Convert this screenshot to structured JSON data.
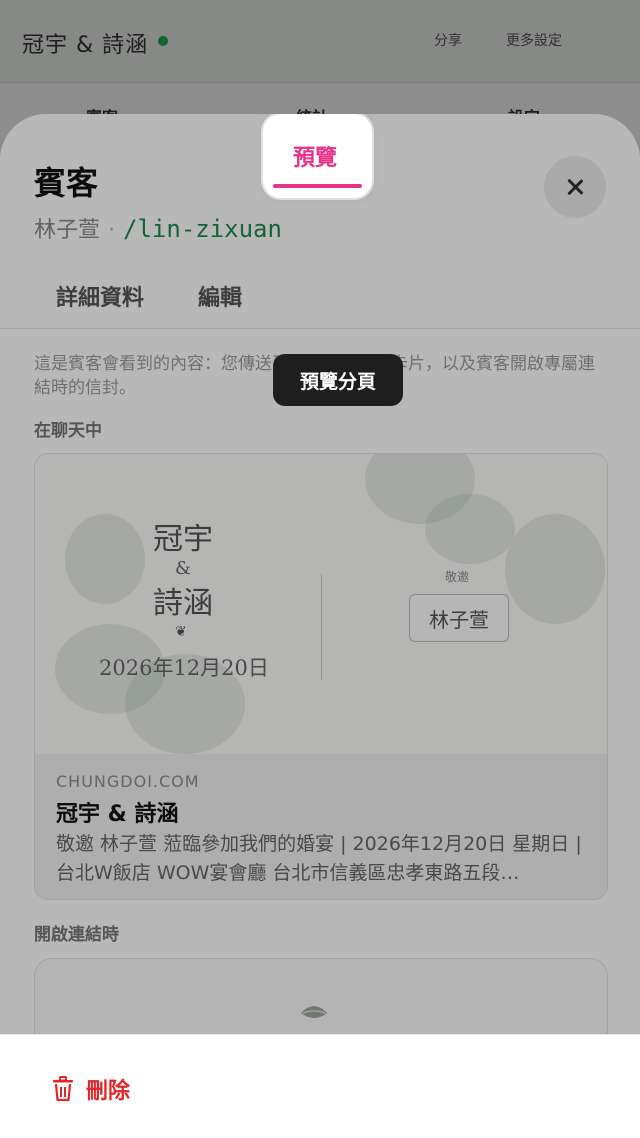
{
  "background": {
    "title": "冠宇 & 詩涵",
    "btn1": "分享",
    "btn2": "更多設定",
    "tabs": [
      "賓客",
      "統計",
      "設定"
    ]
  },
  "sheet": {
    "title": "賓客",
    "guest_name": "林子萱",
    "separator": "·",
    "slug": "/lin-zixuan",
    "tabs": {
      "details": "詳細資料",
      "edit": "編輯",
      "preview": "預覽"
    },
    "tooltip": "預覽分頁",
    "description": "這是賓客會看到的內容：您傳送到聊天中的連結卡片，以及賓客開啟專屬連結時的信封。",
    "in_chat_label": "在聊天中",
    "on_open_label": "開啟連結時",
    "card": {
      "couple_name_1": "冠宇",
      "ampersand": "&",
      "couple_name_2": "詩涵",
      "ornament": "❦",
      "date": "2026年12月20日",
      "invite_label": "敬邀",
      "guest": "林子萱",
      "domain": "CHUNGDOI.COM",
      "title": "冠宇 & 詩涵",
      "desc": "敬邀 林子萱 蒞臨參加我們的婚宴 | 2026年12月20日 星期日 | 台北W飯店 WOW宴會廳 台北市信義區忠孝東路五段…"
    },
    "footer": {
      "delete_label": "刪除"
    }
  },
  "colors": {
    "accent": "#e8338a",
    "slug": "#1a8c52",
    "danger": "#e0282a"
  },
  "icons": {
    "close": "close-icon",
    "delete": "trash-icon",
    "leaf": "leaf-icon"
  }
}
